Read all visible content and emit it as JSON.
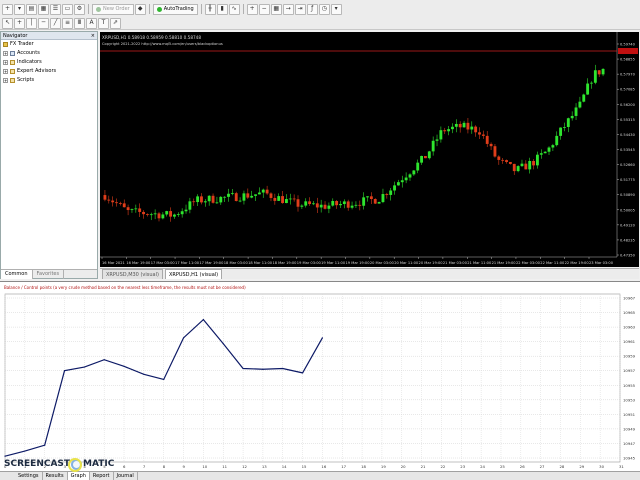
{
  "toolbar": {
    "new_order_label": "New Order",
    "auto_trading_label": "AutoTrading"
  },
  "navigator": {
    "title": "Navigator",
    "items": [
      {
        "label": "FX Trader"
      },
      {
        "label": "Accounts"
      },
      {
        "label": "Indicators"
      },
      {
        "label": "Expert Advisors"
      },
      {
        "label": "Scripts"
      }
    ],
    "tabs": [
      "Common",
      "Favorites"
    ]
  },
  "price_chart": {
    "header": "XRPUSD,H1  0.58918 0.58959 0.58810 0.58748",
    "copyright": "Copyright 2021-2022 http://www.mql5.com/en/users/blackoptionus",
    "price_labels": [
      "0.59740",
      "0.58855",
      "0.57970",
      "0.57085",
      "0.56200",
      "0.55315",
      "0.54430",
      "0.53545",
      "0.52660",
      "0.51775",
      "0.50890",
      "0.50005",
      "0.49120",
      "0.48235",
      "0.47350"
    ],
    "time_labels": [
      "16 Mar 2021",
      "16 Mar 19:00",
      "17 Mar 03:00",
      "17 Mar 11:00",
      "17 Mar 19:00",
      "18 Mar 03:00",
      "18 Mar 11:00",
      "18 Mar 19:00",
      "19 Mar 03:00",
      "19 Mar 11:00",
      "19 Mar 19:00",
      "20 Mar 03:00",
      "20 Mar 11:00",
      "20 Mar 19:00",
      "21 Mar 03:00",
      "21 Mar 11:00",
      "21 Mar 19:00",
      "22 Mar 03:00",
      "22 Mar 11:00",
      "22 Mar 19:00",
      "23 Mar 03:00"
    ],
    "colors": {
      "bull": "#2ee52e",
      "bear": "#e03d1a",
      "background": "#000000",
      "axis_text": "#d8d8d8",
      "level_line": "#d12020"
    }
  },
  "chart_tabs": [
    "XRPUSD,M30 (visual)",
    "XRPUSD,H1 (visual)"
  ],
  "graph": {
    "header": "Balance / Control points (a very crude method based on the nearest less timeframe, the results must not be considered)",
    "y_labels": [
      "10967",
      "10965",
      "10963",
      "10961",
      "10959",
      "10957",
      "10955",
      "10953",
      "10951",
      "10949",
      "10947",
      "10945"
    ],
    "x_labels": [
      "0",
      "1",
      "2",
      "3",
      "4",
      "5",
      "6",
      "7",
      "8",
      "9",
      "10",
      "11",
      "12",
      "13",
      "14",
      "15",
      "16",
      "17",
      "18",
      "19",
      "20",
      "21",
      "22",
      "23",
      "24",
      "25",
      "26",
      "27",
      "28",
      "29",
      "30",
      "31"
    ],
    "line_color": "#0d1a66"
  },
  "chart_data": {
    "type": "line",
    "title": "Balance",
    "x": [
      0,
      1,
      2,
      3,
      4,
      5,
      6,
      7,
      8,
      9,
      10,
      11,
      12,
      13,
      14,
      15,
      16
    ],
    "series": [
      {
        "name": "Balance",
        "values": [
          10944.8,
          10945.5,
          10946.3,
          10956.5,
          10957.0,
          10958.0,
          10957.1,
          10956.0,
          10955.3,
          10961.0,
          10963.5,
          10960.2,
          10956.8,
          10956.7,
          10956.8,
          10956.2,
          10961.0
        ]
      }
    ],
    "xlim": [
      0,
      31
    ],
    "ylim": [
      10944,
      10967
    ]
  },
  "bottom_tabs": [
    "Settings",
    "Results",
    "Graph",
    "Report",
    "Journal"
  ],
  "watermark": {
    "left": "SCREENCAST",
    "right": "MATIC"
  }
}
